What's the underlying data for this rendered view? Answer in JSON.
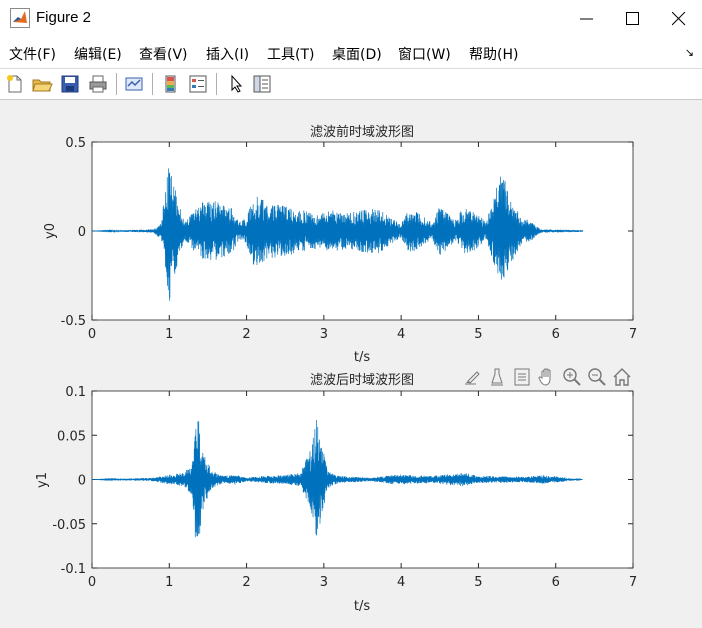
{
  "window": {
    "title": "Figure 2"
  },
  "menu": {
    "items": [
      "文件(F)",
      "编辑(E)",
      "查看(V)",
      "插入(I)",
      "工具(T)",
      "桌面(D)",
      "窗口(W)",
      "帮助(H)"
    ]
  },
  "toolbar": {
    "icons": [
      "new-file-icon",
      "open-folder-icon",
      "save-icon",
      "print-icon",
      "link-plot-icon",
      "insert-colorbar-icon",
      "insert-legend-icon",
      "pointer-icon",
      "property-inspector-icon"
    ]
  },
  "axes_toolbar": {
    "icons": [
      "brush-icon",
      "data-tips-icon",
      "rotate-icon",
      "pan-icon",
      "zoom-in-icon",
      "zoom-out-icon",
      "home-icon"
    ]
  },
  "colors": {
    "line": "#0072bd",
    "axes_bg": "#ffffff",
    "figure_bg": "#f0f0f0",
    "axis_color": "#262626"
  },
  "chart_data": [
    {
      "type": "line",
      "title": "滤波前时域波形图",
      "xlabel": "t/s",
      "ylabel": "y0",
      "xlim": [
        0,
        7
      ],
      "ylim": [
        -0.5,
        0.5
      ],
      "xticks": [
        "0",
        "1",
        "2",
        "3",
        "4",
        "5",
        "6",
        "7"
      ],
      "yticks": [
        "0.5",
        "0",
        "-0.5"
      ],
      "signal_extent": [
        0,
        6.35
      ],
      "envelope": [
        [
          0.0,
          0.0
        ],
        [
          0.8,
          0.01
        ],
        [
          0.9,
          0.05
        ],
        [
          0.93,
          0.18
        ],
        [
          1.0,
          0.42
        ],
        [
          1.03,
          0.3
        ],
        [
          1.1,
          0.2
        ],
        [
          1.2,
          0.05
        ],
        [
          1.3,
          0.1
        ],
        [
          1.4,
          0.16
        ],
        [
          1.6,
          0.17
        ],
        [
          1.8,
          0.14
        ],
        [
          1.9,
          0.05
        ],
        [
          2.0,
          0.08
        ],
        [
          2.1,
          0.2
        ],
        [
          2.3,
          0.16
        ],
        [
          2.5,
          0.14
        ],
        [
          2.7,
          0.12
        ],
        [
          2.9,
          0.1
        ],
        [
          3.0,
          0.1
        ],
        [
          3.1,
          0.12
        ],
        [
          3.3,
          0.1
        ],
        [
          3.5,
          0.12
        ],
        [
          3.7,
          0.13
        ],
        [
          3.85,
          0.08
        ],
        [
          4.0,
          0.04
        ],
        [
          4.1,
          0.13
        ],
        [
          4.3,
          0.08
        ],
        [
          4.4,
          0.05
        ],
        [
          4.5,
          0.14
        ],
        [
          4.7,
          0.06
        ],
        [
          4.8,
          0.13
        ],
        [
          4.95,
          0.11
        ],
        [
          5.1,
          0.05
        ],
        [
          5.3,
          0.35
        ],
        [
          5.4,
          0.2
        ],
        [
          5.55,
          0.08
        ],
        [
          5.7,
          0.05
        ],
        [
          5.8,
          0.01
        ],
        [
          6.35,
          0.005
        ]
      ]
    },
    {
      "type": "line",
      "title": "滤波后时域波形图",
      "xlabel": "t/s",
      "ylabel": "y1",
      "xlim": [
        0,
        7
      ],
      "ylim": [
        -0.1,
        0.1
      ],
      "xticks": [
        "0",
        "1",
        "2",
        "3",
        "4",
        "5",
        "6",
        "7"
      ],
      "yticks": [
        "0.1",
        "0.05",
        "0",
        "-0.05",
        "-0.1"
      ],
      "signal_extent": [
        0,
        6.35
      ],
      "envelope": [
        [
          0.0,
          0.0
        ],
        [
          0.8,
          0.002
        ],
        [
          0.9,
          0.004
        ],
        [
          1.2,
          0.008
        ],
        [
          1.3,
          0.02
        ],
        [
          1.33,
          0.065
        ],
        [
          1.38,
          0.07
        ],
        [
          1.45,
          0.03
        ],
        [
          1.55,
          0.01
        ],
        [
          1.7,
          0.004
        ],
        [
          1.85,
          0.006
        ],
        [
          2.0,
          0.002
        ],
        [
          2.2,
          0.004
        ],
        [
          2.5,
          0.005
        ],
        [
          2.7,
          0.008
        ],
        [
          2.85,
          0.04
        ],
        [
          2.9,
          0.07
        ],
        [
          2.95,
          0.05
        ],
        [
          3.05,
          0.01
        ],
        [
          3.2,
          0.004
        ],
        [
          3.4,
          0.003
        ],
        [
          3.6,
          0.002
        ],
        [
          3.95,
          0.006
        ],
        [
          4.1,
          0.005
        ],
        [
          4.4,
          0.004
        ],
        [
          4.8,
          0.008
        ],
        [
          5.0,
          0.004
        ],
        [
          5.3,
          0.004
        ],
        [
          5.6,
          0.003
        ],
        [
          5.85,
          0.005
        ],
        [
          6.35,
          0.0
        ]
      ]
    }
  ]
}
